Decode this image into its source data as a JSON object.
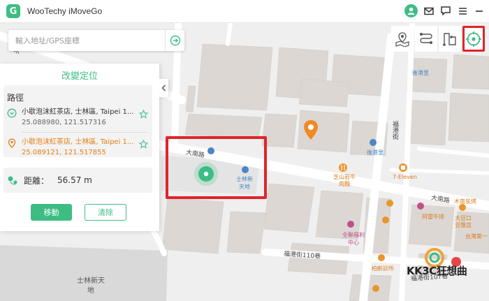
{
  "app": {
    "title": "WooTechy iMoveGo",
    "logo_letter": "G"
  },
  "titlebar_icons": [
    "user-icon",
    "mail-icon",
    "feedback-icon",
    "menu-icon",
    "minimize-icon"
  ],
  "search": {
    "placeholder": "輸入地址/GPS座標"
  },
  "modes": [
    "teleport-mode",
    "two-spot-mode",
    "multi-spot-mode",
    "joystick-mode"
  ],
  "panel": {
    "title": "改變定位",
    "route_heading": "路徑",
    "start": {
      "name": "小歇泡沫紅茶店, 士林區, Taipei 1...",
      "coord": "25.088980, 121.517316"
    },
    "destination": {
      "name": "小歇泡沫紅茶店, 士林區, Taipei 1...",
      "coord": "25.089121, 121.517855"
    },
    "distance_label": "距離：",
    "distance_value": "56.57 m",
    "move_button": "移動",
    "clear_button": "清除"
  },
  "map": {
    "labels": {
      "dananlu_1": "大南路",
      "dananlu_2": "大南路",
      "fugang_st": "福港街",
      "fugang_110": "福港街110巷",
      "fugang_107": "福港街107巷",
      "houkangli_1": "後港里",
      "houkangli_2": "後港里",
      "shilin_station_1": "士林新天地",
      "shilin_station_2": "士林新天地",
      "zhiyun": "芝山岩牛肉麵",
      "seven": "7-Eleven",
      "quanlian": "全聯福利中心",
      "aleiniu": "阿雷牛排",
      "daekou": "大豆口豆漿店",
      "taiwan": "台灣第一",
      "baishi": "柏齡診所",
      "munan": "木南炭烤",
      "mu": "木"
    },
    "watermark": "KK3C狂想曲"
  },
  "colors": {
    "accent": "#3dbd84",
    "destination": "#e77d12",
    "highlight": "#e0242b"
  }
}
